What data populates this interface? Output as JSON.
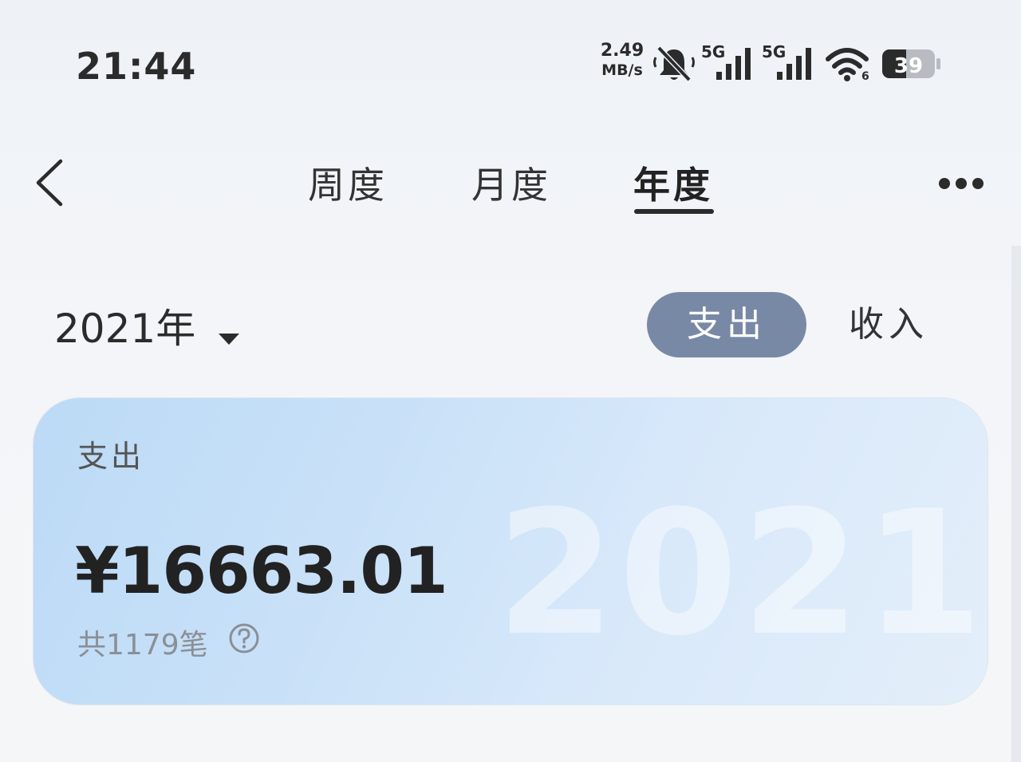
{
  "status_bar": {
    "time": "21:44",
    "net_speed_value": "2.49",
    "net_speed_unit": "MB/s",
    "signal_1": "5G",
    "signal_2": "5G",
    "wifi_badge": "6",
    "battery": "39",
    "icons": [
      "bell-muted-icon",
      "signal-icon",
      "signal-icon",
      "wifi-icon",
      "battery-icon"
    ]
  },
  "header": {
    "back_icon": "chevron-left-icon",
    "tabs": [
      {
        "label": "周度",
        "active": false
      },
      {
        "label": "月度",
        "active": false
      },
      {
        "label": "年度",
        "active": true
      }
    ],
    "more_icon": "more-dots-icon"
  },
  "filter": {
    "year_label": "2021年",
    "type_toggle": [
      {
        "label": "支出",
        "active": true
      },
      {
        "label": "收入",
        "active": false
      }
    ]
  },
  "summary_card": {
    "title": "支出",
    "amount": "¥16663.01",
    "count": "共1179笔",
    "watermark_year": "2021",
    "help_icon": "question-circle-icon"
  },
  "colors": {
    "toggle_active": "#7889a6",
    "card_gradient_start": "#bcdaf6",
    "card_gradient_end": "#e3eef9"
  }
}
